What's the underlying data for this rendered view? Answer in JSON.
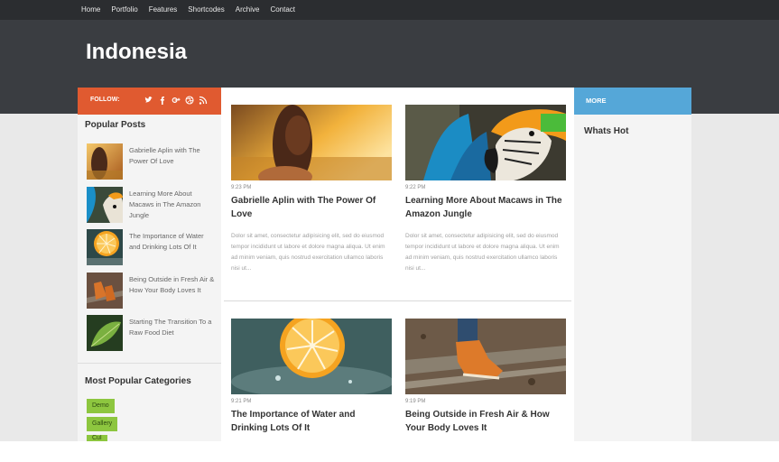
{
  "nav": {
    "items": [
      "Home",
      "Portfolio",
      "Features",
      "Shortcodes",
      "Archive",
      "Contact"
    ]
  },
  "site": {
    "title": "Indonesia"
  },
  "left_sidebar": {
    "follow_label": "FOLLOW:",
    "social_icons": [
      "twitter-icon",
      "facebook-icon",
      "google-plus-icon",
      "dribbble-icon",
      "rss-icon"
    ],
    "popular_title": "Popular Posts",
    "popular_posts": [
      {
        "title": "Gabrielle Aplin with The Power Of Love"
      },
      {
        "title": "Learning More About Macaws in The Amazon Jungle"
      },
      {
        "title": "The Importance of Water and Drinking Lots Of It"
      },
      {
        "title": "Being Outside in Fresh Air & How Your Body Loves It"
      },
      {
        "title": "Starting The Transition To a Raw Food Diet"
      }
    ],
    "categories_title": "Most Popular Categories",
    "categories": [
      "Demo",
      "Gallery",
      "Cul"
    ]
  },
  "posts": [
    {
      "time": "9:23 PM",
      "title": "Gabrielle Aplin with The Power Of Love",
      "excerpt": "Dolor sit amet, consectetur adipisicing elit, sed do eiusmod tempor incididunt ut labore et dolore magna aliqua. Ut enim ad minim veniam, quis nostrud exercitation ullamco laboris nisi ut..."
    },
    {
      "time": "9:22 PM",
      "title": "Learning More About Macaws in The Amazon Jungle",
      "excerpt": "Dolor sit amet, consectetur adipisicing elit, sed do eiusmod tempor incididunt ut labore et dolore magna aliqua. Ut enim ad minim veniam, quis nostrud exercitation ullamco laboris nisi ut..."
    },
    {
      "time": "9:21 PM",
      "title": "The Importance of Water and Drinking Lots Of It",
      "excerpt": ""
    },
    {
      "time": "9:19 PM",
      "title": "Being Outside in Fresh Air & How Your Body Loves It",
      "excerpt": ""
    }
  ],
  "right_sidebar": {
    "more_label": "MORE",
    "whats_hot": "Whats Hot"
  },
  "colors": {
    "follow_bar": "#e05a30",
    "more_bar": "#55a7d8",
    "category_tag": "#8dc63f",
    "header": "#3a3d41",
    "topnav": "#2b2d30"
  }
}
